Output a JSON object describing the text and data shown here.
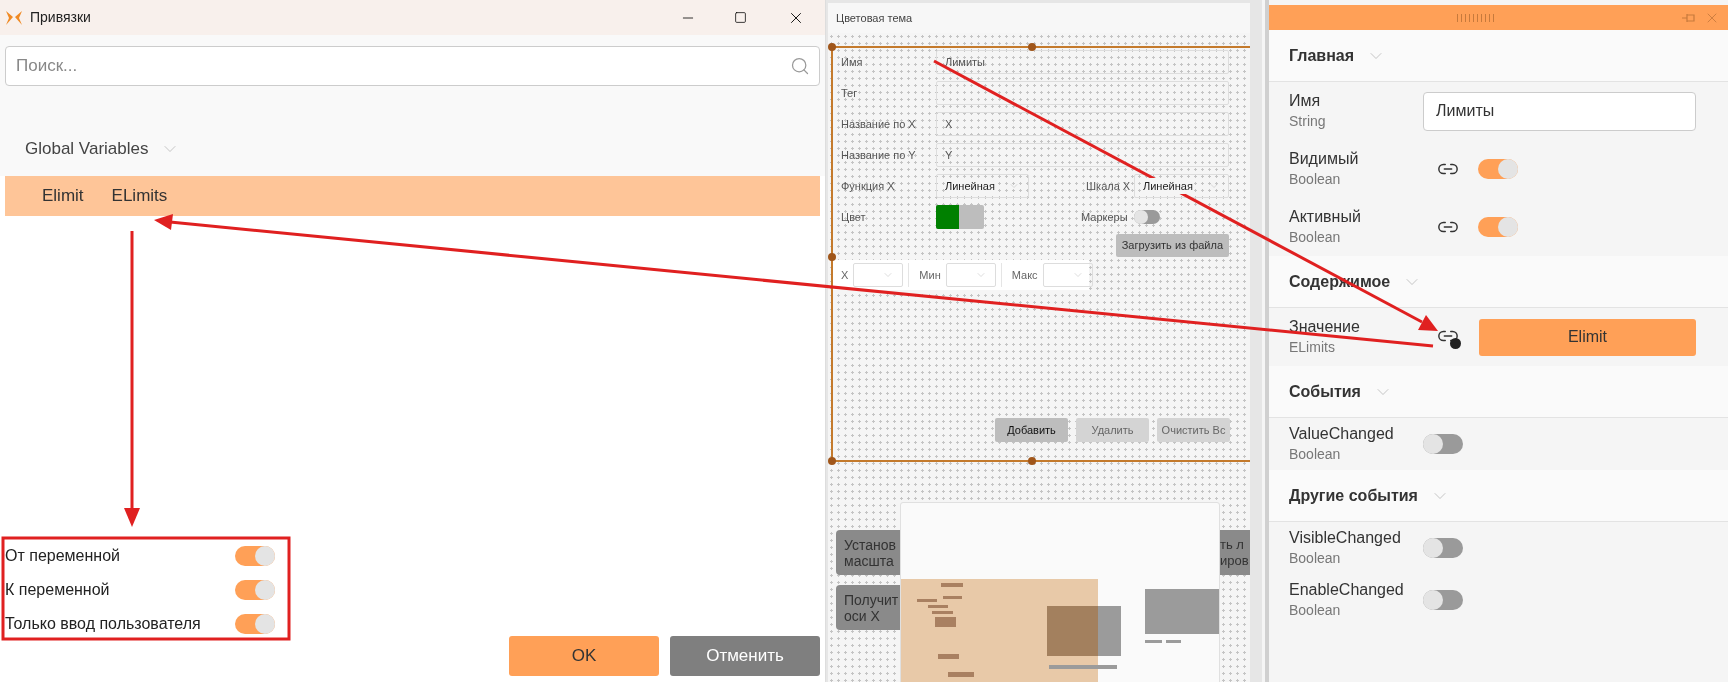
{
  "binding_dialog": {
    "title": "Привязки",
    "search_placeholder": "Поиск...",
    "group": {
      "label": "Global Variables",
      "expanded": true
    },
    "rows": [
      {
        "cells": [
          "Elimit",
          "ELimits"
        ],
        "selected": true
      }
    ],
    "options": [
      {
        "label": "От переменной",
        "on": true
      },
      {
        "label": "К переменной",
        "on": true
      },
      {
        "label": "Только ввод пользователя",
        "on": true
      }
    ],
    "buttons": [
      {
        "label": "OK",
        "kind": "primary"
      },
      {
        "label": "Отменить",
        "kind": "secondary"
      }
    ]
  },
  "designer": {
    "title": "Цветовая тема",
    "fields": [
      {
        "label": "Имя",
        "value": "Лимиты"
      },
      {
        "label": "Тег"
      },
      {
        "label": "Название по X",
        "value": "X"
      },
      {
        "label": "Название по Y",
        "value": "Y"
      }
    ],
    "function_x": {
      "label": "Функция X",
      "value": "Линейная"
    },
    "scale_x": {
      "label": "Шкала X",
      "value": "Линейная"
    },
    "color": {
      "label": "Цвет",
      "color": "#008000"
    },
    "markers": {
      "label": "Маркеры",
      "on": false
    },
    "load_button": "Загрузить из файла",
    "limits": [
      {
        "label": "X"
      },
      {
        "label": "Мин"
      },
      {
        "label": "Макс"
      }
    ],
    "actions": [
      {
        "label": "Добавить",
        "disabled": false
      },
      {
        "label": "Удалить",
        "disabled": true
      },
      {
        "label": "Очистить Вс",
        "disabled": true
      }
    ],
    "covered_buttons": [
      {
        "left_lines": [
          "Установ",
          "масшта"
        ],
        "right_lines": [
          "ть л",
          "иров"
        ]
      },
      {
        "left_lines": [
          "Получит",
          "оси X"
        ]
      }
    ]
  },
  "properties": {
    "sections": [
      {
        "title": "Главная",
        "expanded": true,
        "rows": [
          {
            "kind": "text",
            "name": "Имя",
            "type": "String",
            "value": "Лимиты"
          },
          {
            "kind": "toggle",
            "name": "Видимый",
            "type": "Boolean",
            "linked": true,
            "on": true
          },
          {
            "kind": "toggle",
            "name": "Активный",
            "type": "Boolean",
            "linked": true,
            "on": true
          }
        ]
      },
      {
        "title": "Содержимое",
        "expanded": true,
        "rows": [
          {
            "kind": "binding",
            "name": "Значение",
            "type": "ELimits",
            "value": "Elimit"
          }
        ]
      },
      {
        "title": "События",
        "expanded": true,
        "rows": [
          {
            "kind": "toggle",
            "name": "ValueChanged",
            "type": "Boolean",
            "linked": false,
            "on": false
          }
        ]
      },
      {
        "title": "Другие события",
        "expanded": true,
        "rows": [
          {
            "kind": "toggle",
            "name": "VisibleChanged",
            "type": "Boolean",
            "linked": false,
            "on": false
          },
          {
            "kind": "toggle",
            "name": "EnableChanged",
            "type": "Boolean",
            "linked": false,
            "on": false
          }
        ]
      }
    ]
  }
}
